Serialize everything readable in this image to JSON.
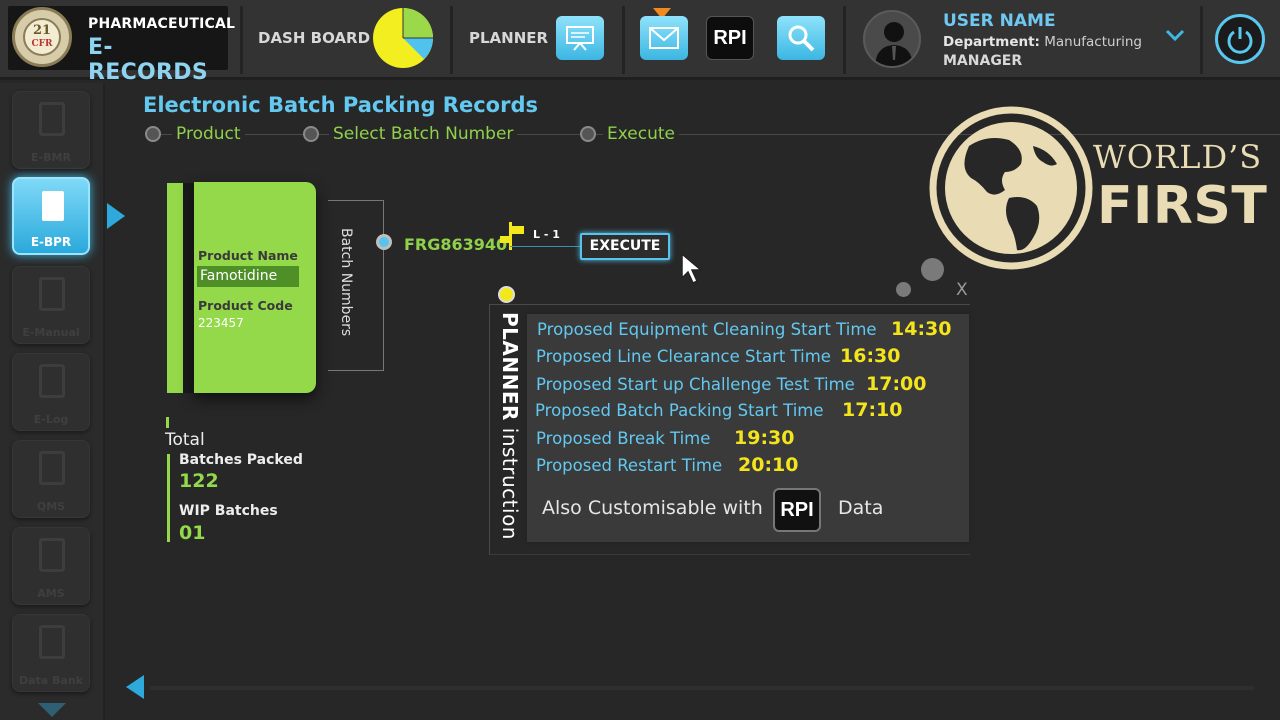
{
  "app": {
    "seal_number": "21",
    "seal_text": "CFR",
    "seal_arc_text": "compliance",
    "logo_line1": "PHARMACEUTICAL",
    "logo_line2": "E-RECORDS"
  },
  "topnav": {
    "dashboard_label": "DASH BOARD",
    "planner_label": "PLANNER",
    "rpi_label": "RPI",
    "icons": [
      "pie-chart-icon",
      "planner-board-icon",
      "mail-icon",
      "rpi-icon",
      "search-icon",
      "power-icon"
    ],
    "pie_colors": {
      "main": "#f2ee20",
      "slice1": "#9bd94b",
      "slice2": "#4fc3ee"
    }
  },
  "user": {
    "name": "USER NAME",
    "department_label": "Department:",
    "department_value": "Manufacturing",
    "role": "MANAGER"
  },
  "sidebar": {
    "items": [
      {
        "label": "E-BMR",
        "icon": "document-icon",
        "active": false
      },
      {
        "label": "E-BPR",
        "icon": "book-icon",
        "active": true
      },
      {
        "label": "E-Manual",
        "icon": "open-book-icon",
        "active": false
      },
      {
        "label": "E-Log",
        "icon": "log-icon",
        "active": false
      },
      {
        "label": "QMS",
        "icon": "checklist-icon",
        "active": false
      },
      {
        "label": "AMS",
        "icon": "palette-icon",
        "active": false
      },
      {
        "label": "Data Bank",
        "icon": "data-bank-icon",
        "active": false
      }
    ]
  },
  "page": {
    "title": "Electronic Batch Packing Records",
    "steps": [
      "Product",
      "Select Batch Number",
      "Execute"
    ]
  },
  "product_card": {
    "name_label": "Product Name",
    "name_value": "Famotidine",
    "code_label": "Product Code",
    "code_value": "223457"
  },
  "batch": {
    "section_label": "Batch Numbers",
    "selected_number": "FRG863940",
    "line_label": "L - 1",
    "execute_label": "EXECUTE"
  },
  "totals": {
    "title": "Total",
    "batches_packed_label": "Batches Packed",
    "batches_packed_value": "122",
    "wip_label": "WIP Batches",
    "wip_value": "01"
  },
  "planner": {
    "title_bold": "PLANNER",
    "title_rest": "instruction",
    "close_label": "X",
    "rows": [
      {
        "label": "Proposed Equipment Cleaning Start Time",
        "time": "14:30"
      },
      {
        "label": "Proposed Line Clearance Start Time",
        "time": "16:30"
      },
      {
        "label": "Proposed Start up Challenge Test Time",
        "time": "17:00"
      },
      {
        "label": "Proposed Batch Packing Start Time",
        "time": "17:10"
      },
      {
        "label": "Proposed Break Time",
        "time": "19:30"
      },
      {
        "label": "Proposed Restart Time",
        "time": "20:10"
      }
    ],
    "custom_prefix": "Also Customisable with",
    "custom_rpi": "RPI",
    "custom_suffix": "Data"
  },
  "badge": {
    "line1": "WORLD’S",
    "line2": "FIRST"
  },
  "colors": {
    "accent_blue": "#64c9f0",
    "accent_green": "#93d94a",
    "accent_yellow": "#f4e41c",
    "background": "#272727"
  }
}
